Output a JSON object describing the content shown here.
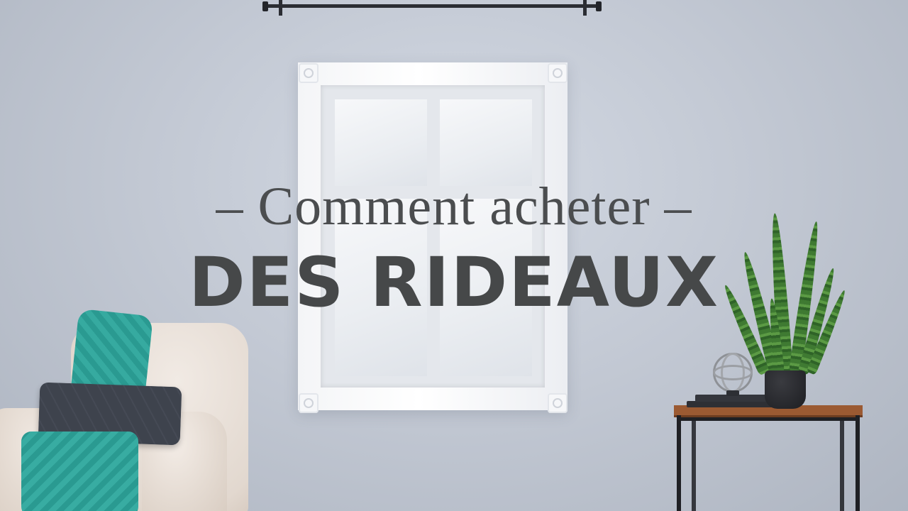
{
  "title": {
    "line1": "– Comment acheter –",
    "line2": "DES RIDEAUX"
  },
  "colors": {
    "wall": "#c3c9d4",
    "title_text": "#4b4d4f",
    "throw_blanket": "#2a9a91",
    "table_top": "#9b5a32"
  }
}
